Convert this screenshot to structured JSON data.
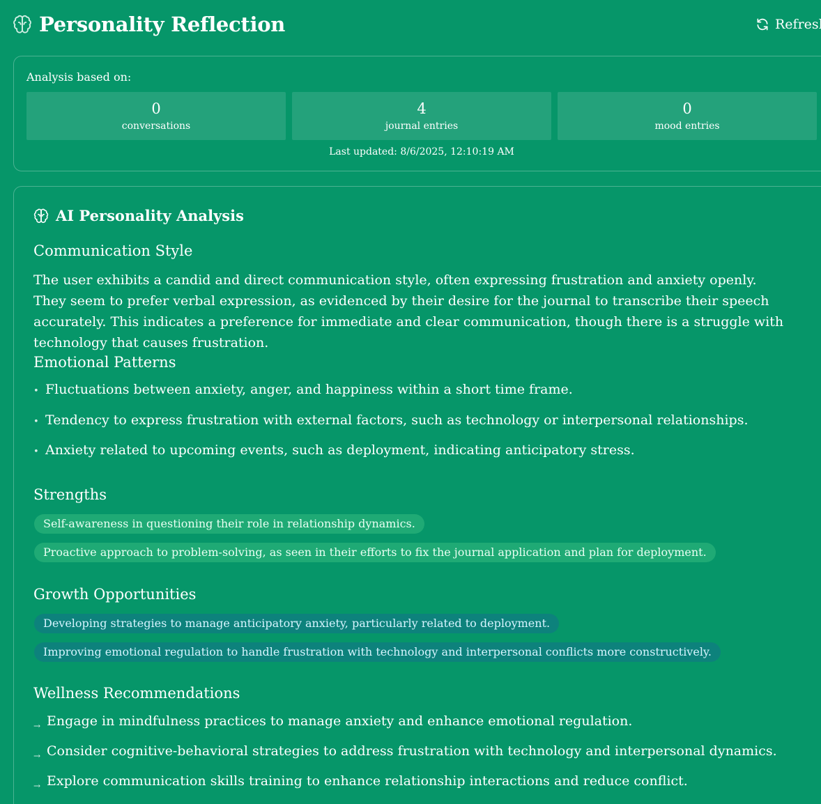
{
  "header": {
    "title": "Personality Reflection",
    "refresh_label": "Refresh"
  },
  "stats": {
    "heading": "Analysis based on:",
    "items": [
      {
        "value": "0",
        "label": "conversations"
      },
      {
        "value": "4",
        "label": "journal entries"
      },
      {
        "value": "0",
        "label": "mood entries"
      }
    ],
    "last_updated": "Last updated: 8/6/2025, 12:10:19 AM"
  },
  "analysis": {
    "title": "AI Personality Analysis",
    "communication": {
      "title": "Communication Style",
      "text": "The user exhibits a candid and direct communication style, often expressing frustration and anxiety openly. They seem to prefer verbal expression, as evidenced by their desire for the journal to transcribe their speech accurately. This indicates a preference for immediate and clear communication, though there is a struggle with technology that causes frustration."
    },
    "emotional": {
      "title": "Emotional Patterns",
      "items": [
        "Fluctuations between anxiety, anger, and happiness within a short time frame.",
        "Tendency to express frustration with external factors, such as technology or interpersonal relationships.",
        "Anxiety related to upcoming events, such as deployment, indicating anticipatory stress."
      ]
    },
    "strengths": {
      "title": "Strengths",
      "items": [
        "Self-awareness in questioning their role in relationship dynamics.",
        "Proactive approach to problem-solving, as seen in their efforts to fix the journal application and plan for deployment."
      ]
    },
    "growth": {
      "title": "Growth Opportunities",
      "items": [
        "Developing strategies to manage anticipatory anxiety, particularly related to deployment.",
        "Improving emotional regulation to handle frustration with technology and interpersonal conflicts more constructively."
      ]
    },
    "wellness": {
      "title": "Wellness Recommendations",
      "items": [
        "Engage in mindfulness practices to manage anxiety and enhance emotional regulation.",
        "Consider cognitive-behavioral strategies to address frustration with technology and interpersonal dynamics.",
        "Explore communication skills training to enhance relationship interactions and reduce conflict."
      ]
    }
  },
  "icons": {
    "title": "brain-icon",
    "refresh": "refresh-icon",
    "analysis": "brain-icon",
    "bullet": "bullet-dot-icon",
    "recommendation": "arrow-right-icon"
  },
  "colors": {
    "background": "#069669",
    "strength_pill": "#3fbf86",
    "growth_pill": "#0f7a84"
  }
}
